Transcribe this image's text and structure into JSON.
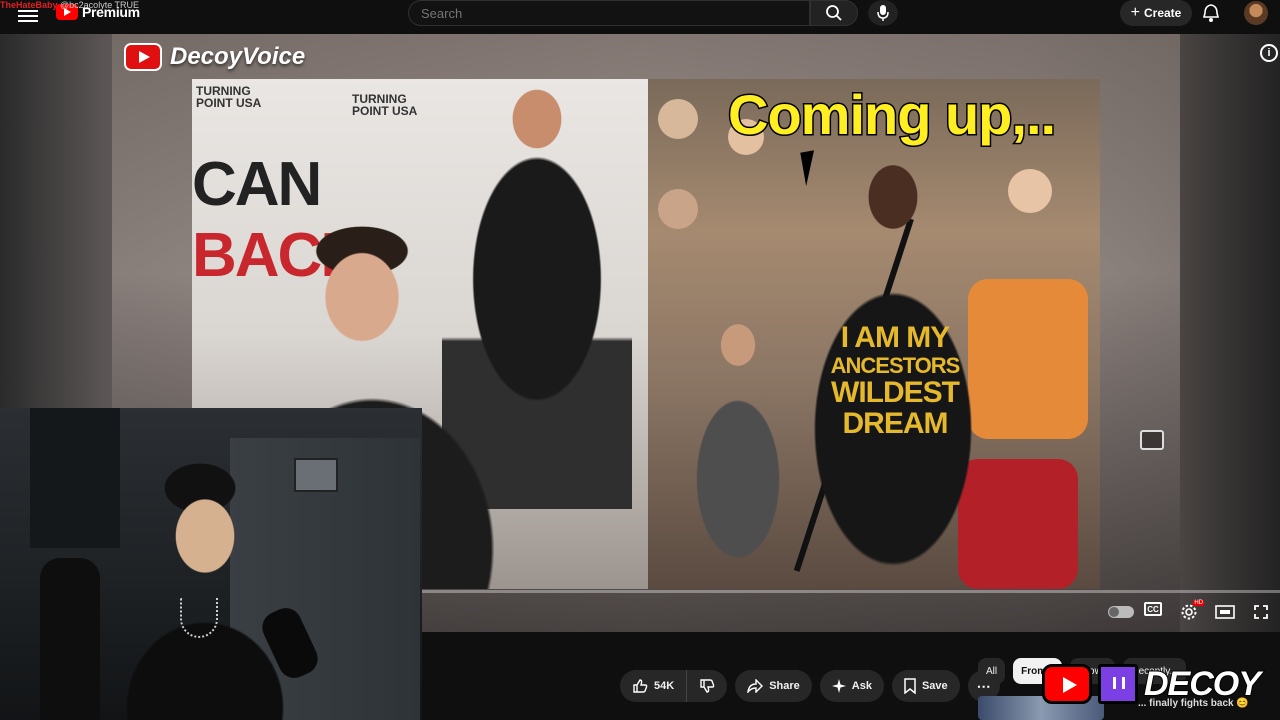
{
  "overlay": {
    "channel_tag": "TheHateBaby",
    "handle_tag": "@bc2acolyte TRUE"
  },
  "header": {
    "logo_text": "Premium",
    "search_placeholder": "Search",
    "create_label": "Create"
  },
  "video": {
    "watermark_text": "DecoyVoice",
    "caption": "Coming up,..",
    "shirt_lines": [
      "I AM MY",
      "ANCESTORS",
      "WILDEST",
      "DREAM"
    ],
    "banner_text": [
      "CAN",
      "BACK"
    ],
    "sign_text": [
      "TURNING",
      "POINT USA"
    ]
  },
  "controls": {
    "cc_label": "CC",
    "hd_badge": "HD"
  },
  "actions": {
    "likes": "54K",
    "share": "Share",
    "ask": "Ask",
    "save": "Save",
    "more": "⋯"
  },
  "chips": [
    "All",
    "From...",
    "...lowe",
    "Recently..."
  ],
  "recommendation": {
    "title": "... finally fights back 😊"
  },
  "brand_overlay": {
    "text": "DECOY"
  },
  "colors": {
    "yt_red": "#ff0000",
    "caption_yellow": "#ffee22",
    "twitch_purple": "#7b3fe4"
  }
}
